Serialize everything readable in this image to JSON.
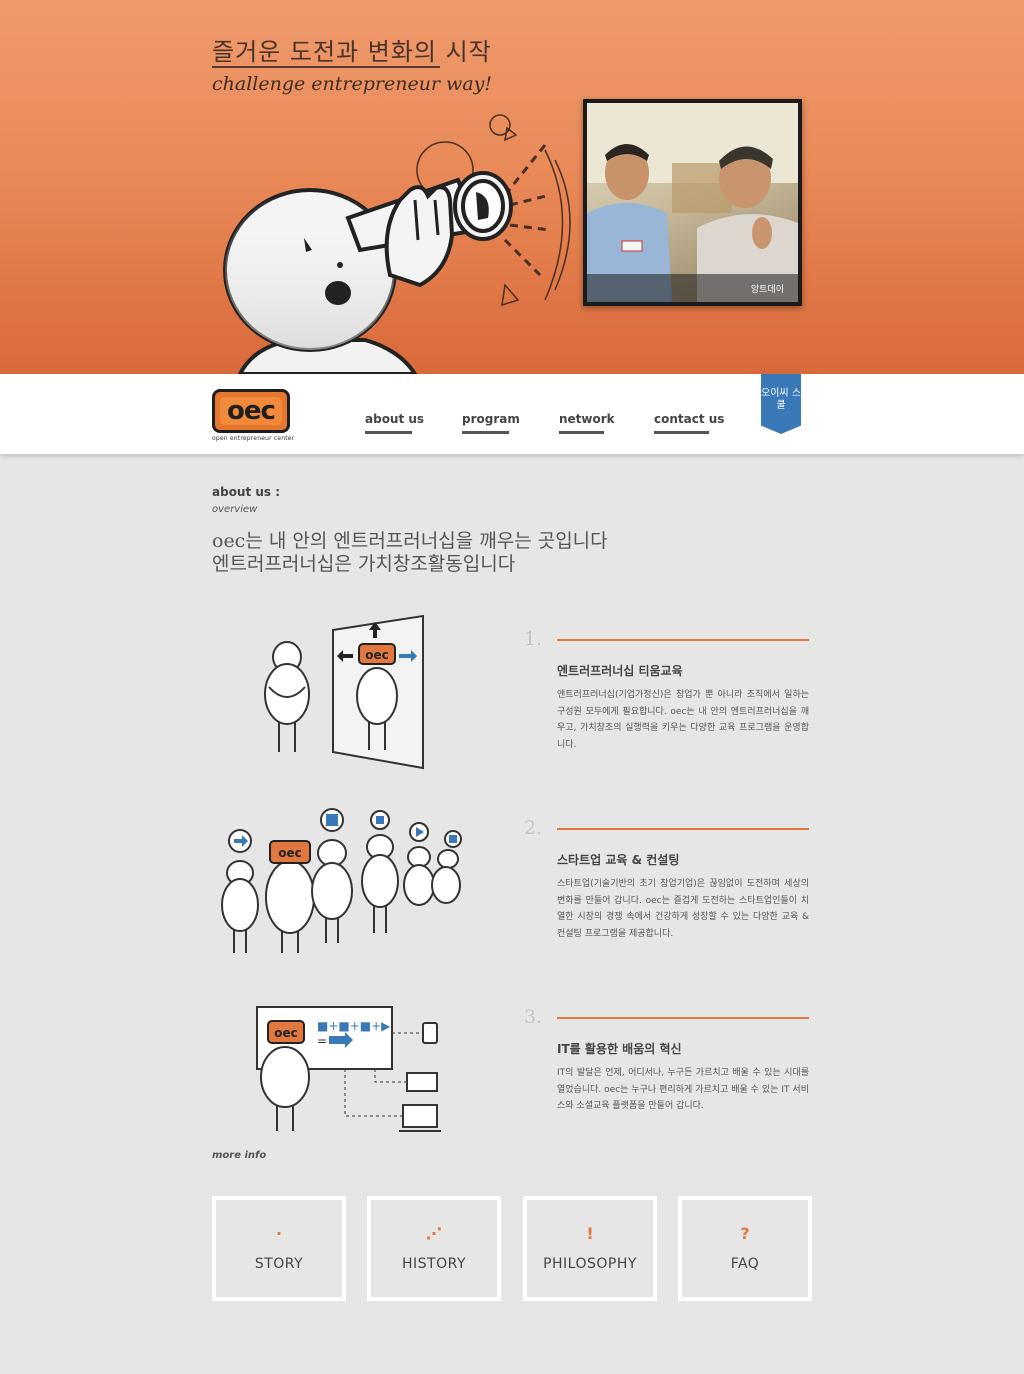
{
  "hero": {
    "title": "즐거운 도전과 변화의 시작",
    "subtitle": "challenge entrepreneur way!",
    "photo_caption": "앙트데이"
  },
  "nav": {
    "logo_text": "oec",
    "logo_tagline": "open entrepreneur center",
    "items": [
      {
        "label": "about us"
      },
      {
        "label": "program"
      },
      {
        "label": "network"
      },
      {
        "label": "contact us"
      }
    ],
    "ribbon_label": "오이씨 스쿨"
  },
  "section": {
    "title": "about us :",
    "subtitle": "overview",
    "lead_line1": "oec는 내 안의 엔트러프러너십을 깨우는 곳입니다",
    "lead_line2": "엔트러프러너십은 가치창조활동입니다"
  },
  "features": [
    {
      "number": "1.",
      "heading": "엔트러프러너십 티움교육",
      "body": "엔트러프러너십(기업가정신)은 창업가 뿐 아니라 조직에서 일하는 구성원 모두에게 필요합니다. oec는 내 안의 엔트러프러너십을 깨우고, 가치창조의 실행력을 키우는 다양한 교육 프로그램을 운영합니다."
    },
    {
      "number": "2.",
      "heading": "스타트업 교육 & 컨설팅",
      "body": "스타트업(기술기반의 초기 창업기업)은 끊임없이 도전하며 세상의 변화를 만들어 갑니다. oec는 즐겁게 도전하는 스타트업인들이 치열한 시장의 경쟁 속에서 건강하게 성장할 수 있는 다양한 교육 & 컨설팅 프로그램을 제공합니다."
    },
    {
      "number": "3.",
      "heading": "IT를 활용한 배움의 혁신",
      "body": "IT의 발달은 언제, 어디서나, 누구든 가르치고 배울 수 있는 시대를 열었습니다. oec는 누구나 편리하게 가르치고 배울 수 있는 IT 서비스와 소셜교육 플랫폼을 만들어 갑니다."
    }
  ],
  "illustration_text": {
    "badge": "oec",
    "equation_top": "■+■+■+▶",
    "equation_bottom": "="
  },
  "more_info": "more info",
  "cards": [
    {
      "icon": "·",
      "label": "STORY"
    },
    {
      "icon": "⋰",
      "label": "HISTORY"
    },
    {
      "icon": "!",
      "label": "PHILOSOPHY"
    },
    {
      "icon": "?",
      "label": "FAQ"
    }
  ],
  "colors": {
    "hero_top": "#ef9a6c",
    "hero_bottom": "#d9693a",
    "accent": "#e07840",
    "ribbon": "#3a79b8",
    "background": "#e6e6e6"
  }
}
